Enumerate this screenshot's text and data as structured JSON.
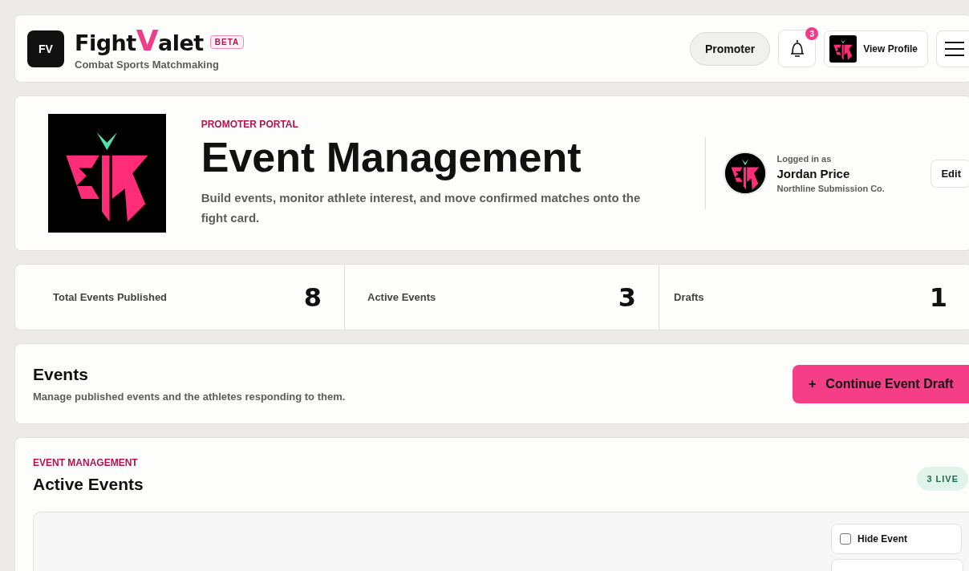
{
  "header": {
    "logo_badge": "FV",
    "brand": {
      "first": "Fight",
      "accent": "V",
      "rest": "alet"
    },
    "beta": "BETA",
    "tagline": "Combat Sports Matchmaking",
    "role_button": "Promoter",
    "notifications": "3",
    "profile_button": "View Profile"
  },
  "hero": {
    "eyebrow": "PROMOTER PORTAL",
    "title": "Event Management",
    "description": "Build events, monitor athlete interest, and move confirmed matches onto the fight card.",
    "account": {
      "caption": "Logged in as",
      "name": "Jordan Price",
      "org": "Northline Submission Co.",
      "edit": "Edit"
    }
  },
  "stats": [
    {
      "label": "Total Events Published",
      "value": "8"
    },
    {
      "label": "Active Events",
      "value": "3"
    },
    {
      "label": "Drafts",
      "value": "1"
    }
  ],
  "events": {
    "title": "Events",
    "subtitle": "Manage published events and the athletes responding to them.",
    "button_icon": "+",
    "button": "Continue Event Draft"
  },
  "active": {
    "eyebrow": "EVENT MANAGEMENT",
    "title": "Active Events",
    "badge": "3 LIVE",
    "controls": [
      {
        "label": "Hide Event",
        "checked": false
      }
    ]
  }
}
